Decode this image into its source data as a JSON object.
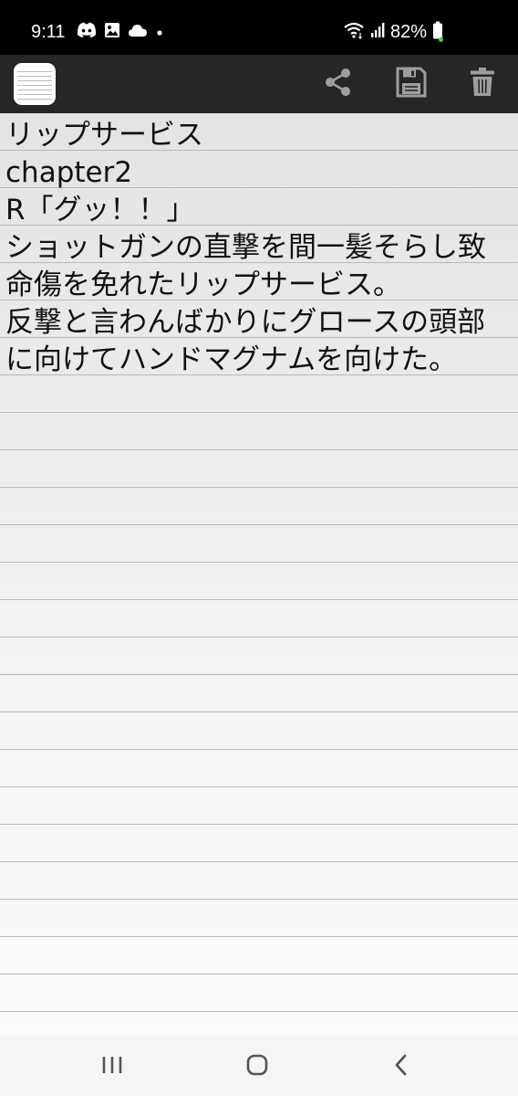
{
  "status_bar": {
    "time": "9:11",
    "battery_percent": "82%",
    "left_icons": [
      "discord-icon",
      "gallery-icon",
      "cloud-icon",
      "dot-icon"
    ],
    "right_icons": [
      "wifi-icon",
      "signal-icon",
      "battery-icon"
    ]
  },
  "toolbar": {
    "logo_icon": "notepad-icon",
    "buttons": [
      "share-icon",
      "save-icon",
      "delete-icon"
    ]
  },
  "note": {
    "text": "リップサービス\nchapter2\nR「グッ！！」\nショットガンの直撃を間一髪そらし致命傷を免れたリップサービス。\n反撃と言わんばかりにグロースの頭部に向けてハンドマグナムを向けた。"
  },
  "nav_bar": {
    "buttons": [
      "recent-apps-icon",
      "home-icon",
      "back-icon"
    ]
  },
  "colors": {
    "status_bar_bg": "#000000",
    "app_bar_bg": "#262626",
    "toolbar_icon": "#9e9e9e",
    "paper_line": "#b9b9b9",
    "nav_bar_bg": "#f5f5f5"
  }
}
